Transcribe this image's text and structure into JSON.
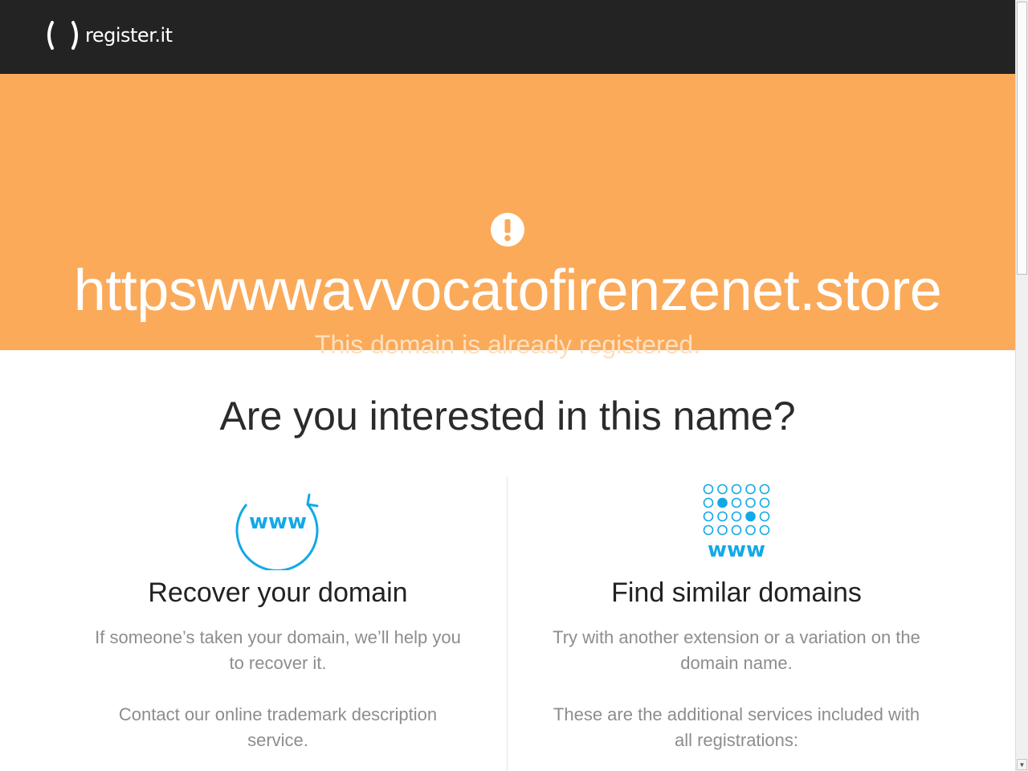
{
  "header": {
    "logo_text": "register.it",
    "logo_icon": "parentheses-logo-icon"
  },
  "banner": {
    "alert_icon": "exclamation-circle-icon",
    "domain": "httpswwwavvocatofirenzenet.store",
    "status": "This domain is already registered.",
    "background_color": "#fbaa5a"
  },
  "main": {
    "question": "Are you interested in this name?",
    "recover": {
      "icon": "www-refresh-icon",
      "icon_text": "www",
      "title": "Recover your domain",
      "text1": "If someone’s taken your domain, we’ll help you to recover it.",
      "text2": "Contact our online trademark description service."
    },
    "similar": {
      "icon": "www-dot-grid-icon",
      "icon_text": "www",
      "title": "Find similar domains",
      "text1": "Try with another extension or a variation on the domain name.",
      "text2": "These are the additional services included with all registrations:"
    },
    "accent_color": "#12a9e6"
  },
  "scrollbar": {
    "up_arrow": "▲",
    "down_arrow": "▼"
  }
}
